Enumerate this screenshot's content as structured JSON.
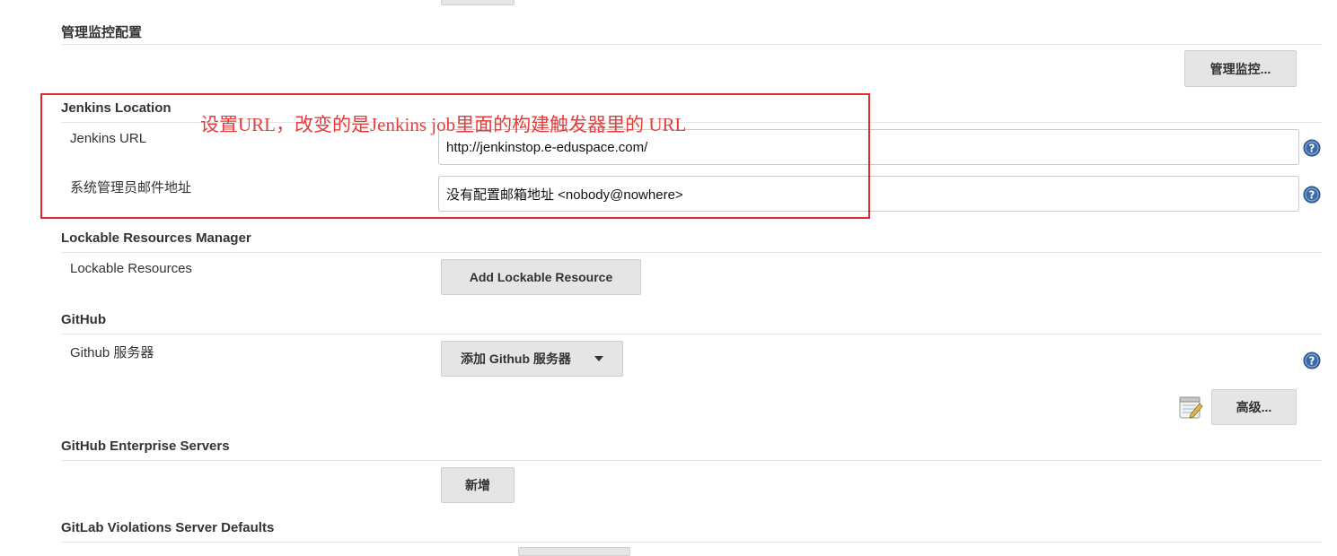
{
  "sections": {
    "monitor": {
      "title": "管理监控配置",
      "button_label": "管理监控..."
    },
    "jenkins_location": {
      "title": "Jenkins Location",
      "url_label": "Jenkins URL",
      "url_value": "http://jenkinstop.e-eduspace.com/",
      "email_label": "系统管理员邮件地址",
      "email_value": "没有配置邮箱地址 <nobody@nowhere>"
    },
    "lockable": {
      "title": "Lockable Resources Manager",
      "label": "Lockable Resources",
      "button_label": "Add Lockable Resource"
    },
    "github": {
      "title": "GitHub",
      "label": "Github 服务器",
      "add_button_label": "添加 Github 服务器",
      "advanced_button_label": "高级..."
    },
    "github_enterprise": {
      "title": "GitHub Enterprise Servers",
      "add_button_label": "新增"
    },
    "gitlab": {
      "title": "GitLab Violations Server Defaults"
    }
  },
  "annotation": {
    "text": "设置URL，改变的是Jenkins job里面的构建触发器里的 URL",
    "color": "#e0282e"
  },
  "icons": {
    "help": "help-question-icon",
    "notepad": "notepad-icon",
    "dropdown": "caret-down-icon"
  },
  "colors": {
    "button_bg": "#e5e5e5",
    "help_icon": "#3c6aa6"
  }
}
